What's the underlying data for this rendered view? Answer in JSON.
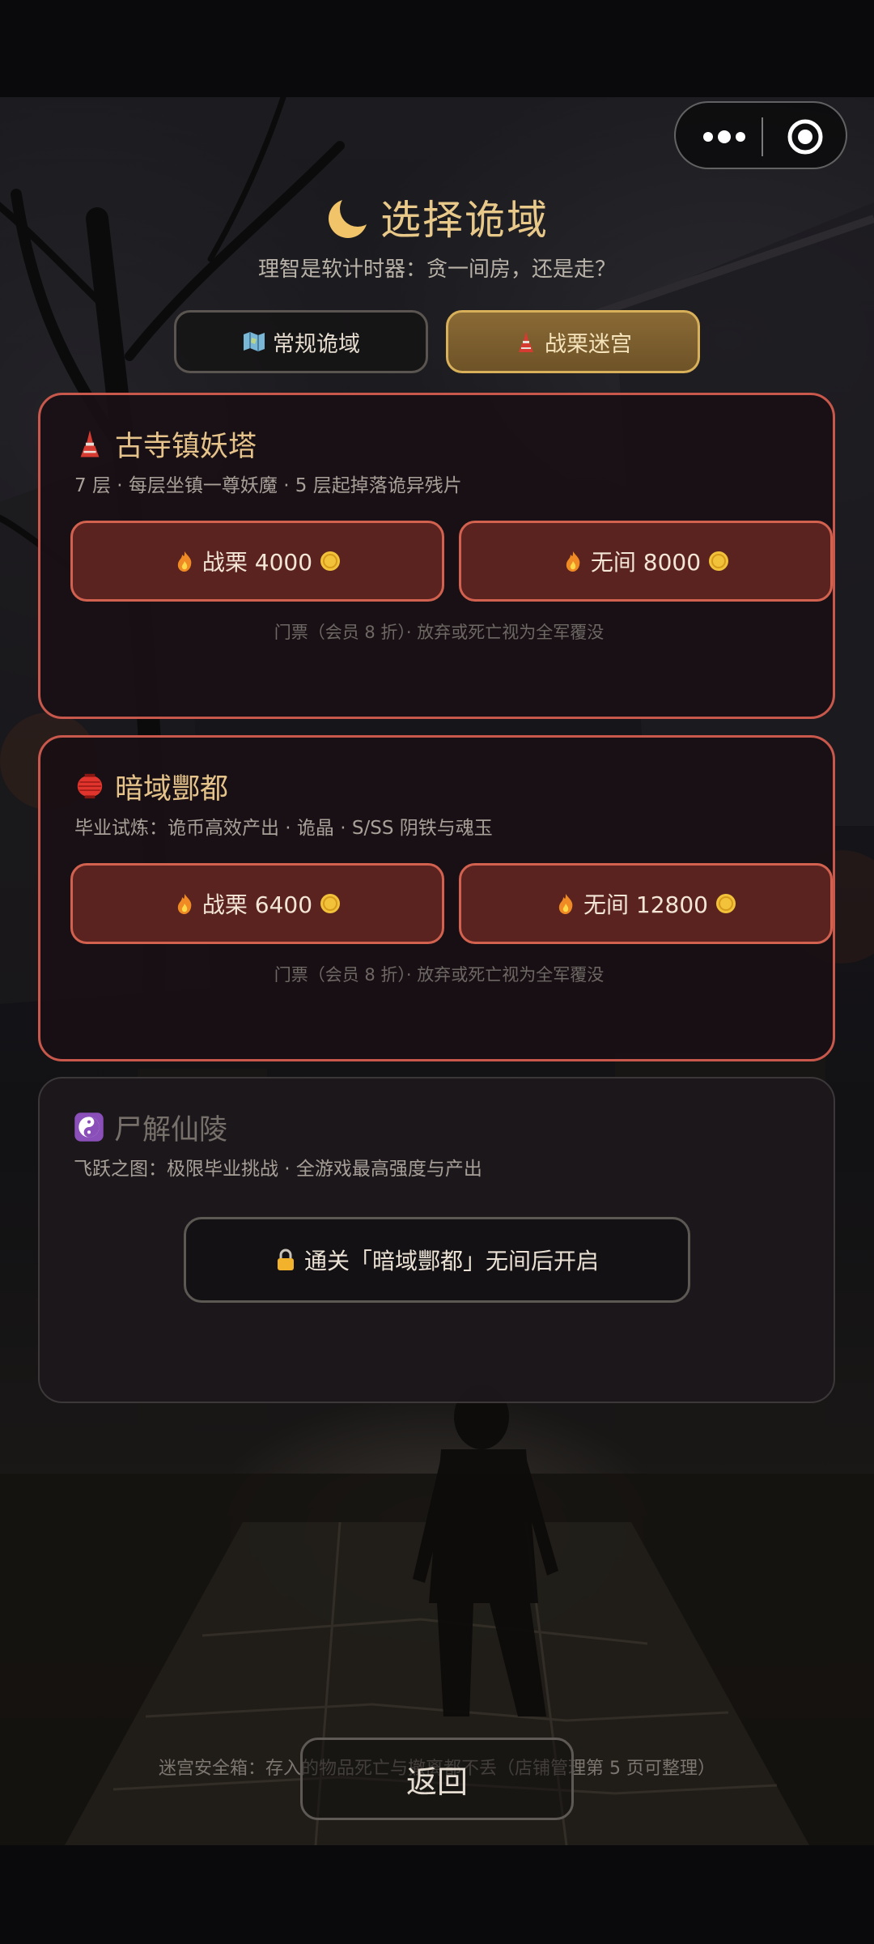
{
  "header": {
    "title": "选择诡域",
    "subtitle": "理智是软计时器：贪一间房，还是走？"
  },
  "tabs": [
    {
      "label": "常规诡域",
      "icon": "map-icon",
      "active": false
    },
    {
      "label": "战栗迷宫",
      "icon": "tower-icon",
      "active": true
    }
  ],
  "dungeons": [
    {
      "title": "古寺镇妖塔",
      "icon": "tower-icon",
      "description": "7 层 · 每层坐镇一尊妖魔 · 5 层起掉落诡异残片",
      "buttons": [
        {
          "label": "战栗 4000",
          "icon": "fire-icon",
          "currency_icon": "coin-icon"
        },
        {
          "label": "无间 8000",
          "icon": "fire-icon",
          "currency_icon": "coin-icon"
        }
      ],
      "note": "门票（会员 8 折）· 放弃或死亡视为全军覆没"
    },
    {
      "title": "暗域酆都",
      "icon": "red-lantern-icon",
      "description": "毕业试炼：诡币高效产出 · 诡晶 · S/SS 阴铁与魂玉",
      "buttons": [
        {
          "label": "战栗 6400",
          "icon": "fire-icon",
          "currency_icon": "coin-icon"
        },
        {
          "label": "无间 12800",
          "icon": "fire-icon",
          "currency_icon": "coin-icon"
        }
      ],
      "note": "门票（会员 8 折）· 放弃或死亡视为全军覆没"
    },
    {
      "title": "尸解仙陵",
      "icon": "yin-yang-icon",
      "description": "飞跃之图：极限毕业挑战 · 全游戏最高强度与产出",
      "locked": true,
      "lock_label": "通关「暗域酆都」无间后开启"
    }
  ],
  "footer": {
    "note": "迷宫安全箱：存入的物品死亡与撤离都不丢（店铺管理第 5 页可整理）",
    "back_label": "返回"
  },
  "colors": {
    "accent_gold": "#e5c38a",
    "card_border_red": "#c8584c",
    "button_fill": "#5a2320",
    "tab_active": "#8a6a35"
  }
}
